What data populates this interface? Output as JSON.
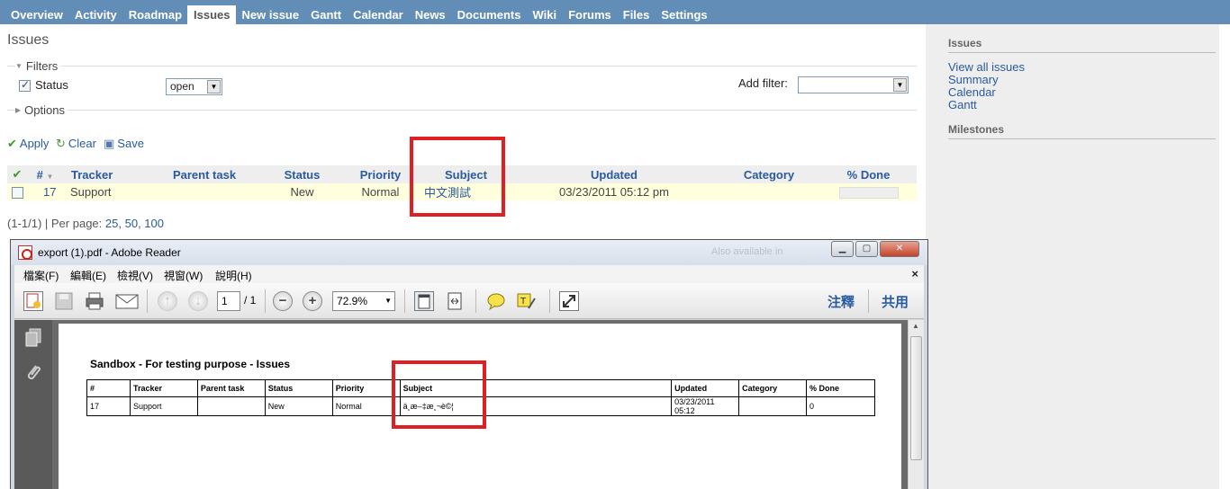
{
  "tabs": [
    "Overview",
    "Activity",
    "Roadmap",
    "Issues",
    "New issue",
    "Gantt",
    "Calendar",
    "News",
    "Documents",
    "Wiki",
    "Forums",
    "Files",
    "Settings"
  ],
  "selected_tab": "Issues",
  "page_title": "Issues",
  "filters": {
    "legend": "Filters",
    "status_label": "Status",
    "status_value": "open",
    "add_filter_label": "Add filter:",
    "options_legend": "Options"
  },
  "actions": {
    "apply": "Apply",
    "clear": "Clear",
    "save": "Save"
  },
  "table": {
    "columns": [
      "#",
      "Tracker",
      "Parent task",
      "Status",
      "Priority",
      "Subject",
      "Updated",
      "Category",
      "% Done"
    ],
    "rows": [
      {
        "id": "17",
        "tracker": "Support",
        "parent": "",
        "status": "New",
        "priority": "Normal",
        "subject": "中文測試",
        "updated": "03/23/2011 05:12 pm",
        "category": "",
        "done": 0
      }
    ]
  },
  "pagination": {
    "summary": "(1-1/1) | Per page:",
    "options": [
      "25",
      "50",
      "100"
    ]
  },
  "sidebar": {
    "issues_heading": "Issues",
    "links": [
      "View all issues",
      "Summary",
      "Calendar",
      "Gantt"
    ],
    "milestones_heading": "Milestones"
  },
  "reader": {
    "window_title": "export (1).pdf - Adobe Reader",
    "blurred_text": "Also available in",
    "menu": [
      "檔案(F)",
      "編輯(E)",
      "檢視(V)",
      "視窗(W)",
      "說明(H)"
    ],
    "page_current": "1",
    "page_total": "/ 1",
    "zoom": "72.9%",
    "right_links": [
      "注釋",
      "共用"
    ],
    "pdf": {
      "title": "Sandbox - For testing purpose - Issues",
      "columns": [
        "#",
        "Tracker",
        "Parent task",
        "Status",
        "Priority",
        "Subject",
        "Updated",
        "Category",
        "% Done"
      ],
      "row": [
        "17",
        "Support",
        "",
        "New",
        "Normal",
        "ä¸­æ–‡æ¸¬è©¦",
        "03/23/2011 05:12",
        "",
        "0"
      ]
    }
  },
  "colors": {
    "topbar": "#628db6",
    "link": "#2a5a9f",
    "highlight_box": "#e01f25",
    "row_bg": "#ffffdd"
  }
}
